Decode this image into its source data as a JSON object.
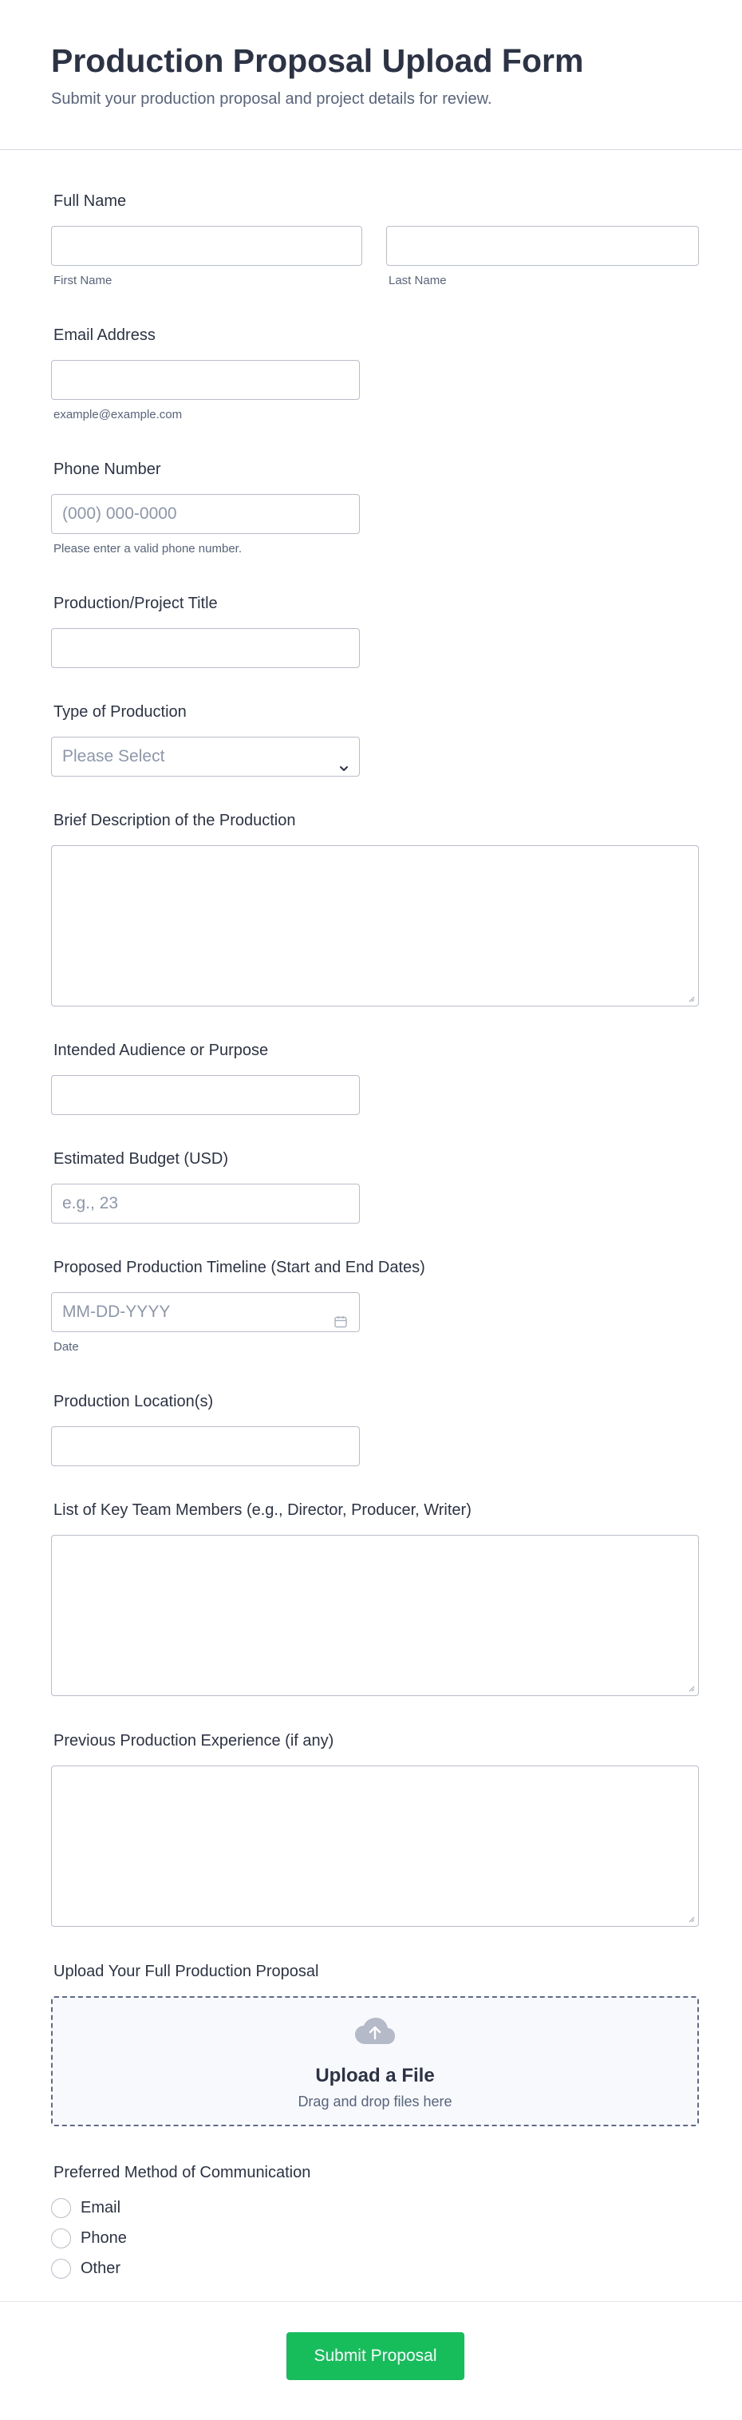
{
  "header": {
    "title": "Production Proposal Upload Form",
    "subtitle": "Submit your production proposal and project details for review."
  },
  "fields": {
    "full_name": {
      "label": "Full Name",
      "first_sub": "First Name",
      "last_sub": "Last Name",
      "first_value": "",
      "last_value": ""
    },
    "email": {
      "label": "Email Address",
      "sub": "example@example.com",
      "value": ""
    },
    "phone": {
      "label": "Phone Number",
      "placeholder": "(000) 000-0000",
      "sub": "Please enter a valid phone number."
    },
    "title": {
      "label": "Production/Project Title",
      "value": ""
    },
    "type": {
      "label": "Type of Production",
      "selected": "Please Select"
    },
    "description": {
      "label": "Brief Description of the Production"
    },
    "audience": {
      "label": "Intended Audience or Purpose",
      "value": ""
    },
    "budget": {
      "label": "Estimated Budget (USD)",
      "placeholder": "e.g., 23"
    },
    "timeline": {
      "label": "Proposed Production Timeline (Start and End Dates)",
      "placeholder": "MM-DD-YYYY",
      "sub": "Date"
    },
    "location": {
      "label": "Production Location(s)",
      "value": ""
    },
    "team": {
      "label": "List of Key Team Members (e.g., Director, Producer, Writer)"
    },
    "experience": {
      "label": "Previous Production Experience (if any)"
    },
    "upload": {
      "label": "Upload Your Full Production Proposal",
      "title": "Upload a File",
      "hint": "Drag and drop files here"
    },
    "communication": {
      "label": "Preferred Method of Communication",
      "options": [
        "Email",
        "Phone",
        "Other"
      ]
    }
  },
  "submit_label": "Submit Proposal",
  "colors": {
    "accent": "#18bd5b",
    "text": "#2c3345",
    "muted": "#57647e",
    "border": "#b8bdc9"
  },
  "icons": {
    "select": "chevron-down-icon",
    "date": "calendar-icon",
    "upload": "cloud-upload-icon"
  }
}
